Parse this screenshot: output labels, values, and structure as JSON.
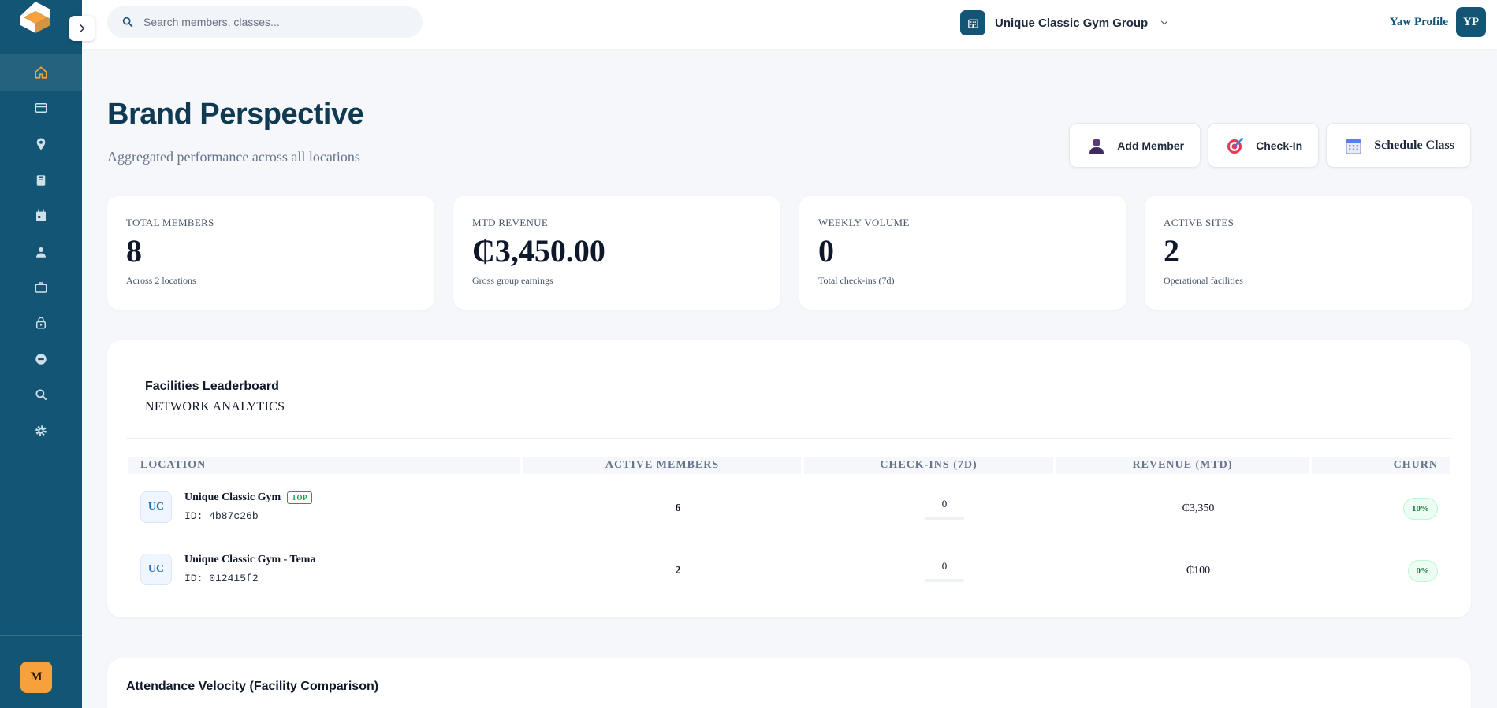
{
  "header": {
    "search_placeholder": "Search members, classes...",
    "org_name": "Unique Classic Gym Group",
    "profile_name": "Yaw Profile",
    "profile_initials": "YP"
  },
  "sidebar": {
    "items": [
      {
        "icon": "home-icon",
        "active": true
      },
      {
        "icon": "card-icon"
      },
      {
        "icon": "location-pin-icon"
      },
      {
        "icon": "book-icon"
      },
      {
        "icon": "calendar-icon"
      },
      {
        "icon": "user-icon"
      },
      {
        "icon": "briefcase-icon"
      },
      {
        "icon": "lock-icon"
      },
      {
        "icon": "minus-circle-icon"
      },
      {
        "icon": "search-icon"
      },
      {
        "icon": "gear-icon"
      }
    ],
    "user_initial": "M"
  },
  "page": {
    "title": "Brand Perspective",
    "subtitle": "Aggregated performance across all locations"
  },
  "actions": {
    "add_member": "Add Member",
    "check_in": "Check-In",
    "schedule_class": "Schedule Class"
  },
  "stats": [
    {
      "label": "TOTAL MEMBERS",
      "value": "8",
      "sub": "Across 2 locations"
    },
    {
      "label": "MTD REVENUE",
      "value": "₵3,450.00",
      "sub": "Gross group earnings"
    },
    {
      "label": "WEEKLY VOLUME",
      "value": "0",
      "sub": "Total check-ins (7d)"
    },
    {
      "label": "ACTIVE SITES",
      "value": "2",
      "sub": "Operational facilities"
    }
  ],
  "leaderboard": {
    "title": "Facilities Leaderboard",
    "subtitle": "NETWORK ANALYTICS",
    "columns": [
      "LOCATION",
      "ACTIVE MEMBERS",
      "CHECK-INS (7D)",
      "REVENUE (MTD)",
      "CHURN"
    ],
    "rows": [
      {
        "initials": "UC",
        "name": "Unique Classic Gym",
        "badge": "TOP",
        "id": "ID: 4b87c26b",
        "members": "6",
        "checkins": "0",
        "checkins_fraction": 0,
        "revenue": "₵3,350",
        "churn": "10%"
      },
      {
        "initials": "UC",
        "name": "Unique Classic Gym - Tema",
        "badge": "",
        "id": "ID: 012415f2",
        "members": "2",
        "checkins": "0",
        "checkins_fraction": 0,
        "revenue": "₵100",
        "churn": "0%"
      }
    ]
  },
  "attendance": {
    "title": "Attendance Velocity (Facility Comparison)"
  },
  "colors": {
    "sidebar": "#135574",
    "accent": "#f6a13c",
    "success": "#16a34a"
  }
}
